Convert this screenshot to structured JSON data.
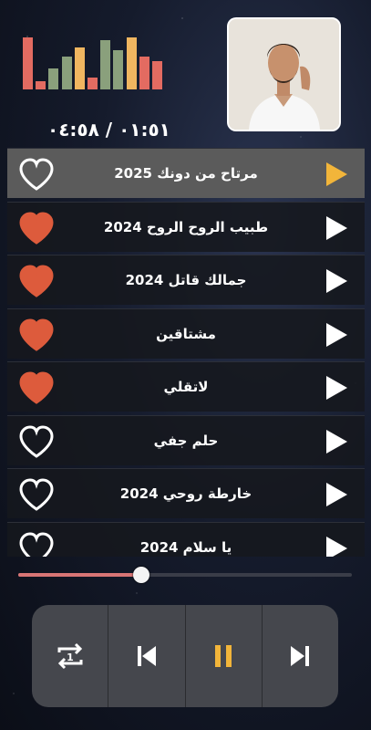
{
  "player": {
    "time_display": "٠١:٥١ / ٠٤:٥٨",
    "progress_fraction": 0.37,
    "equalizer": [
      {
        "level": 0.98,
        "color": "#e36b61"
      },
      {
        "level": 0.16,
        "color": "#e36b61"
      },
      {
        "level": 0.4,
        "color": "#8aa07c"
      },
      {
        "level": 0.62,
        "color": "#8aa07c"
      },
      {
        "level": 0.79,
        "color": "#f0b660"
      },
      {
        "level": 0.22,
        "color": "#e36b61"
      },
      {
        "level": 0.93,
        "color": "#8aa07c"
      },
      {
        "level": 0.74,
        "color": "#8aa07c"
      },
      {
        "level": 0.98,
        "color": "#f0b660"
      },
      {
        "level": 0.62,
        "color": "#e36b61"
      },
      {
        "level": 0.54,
        "color": "#e36b61"
      }
    ]
  },
  "songs": [
    {
      "title": "مرتاح من دونك 2025",
      "favorite": false,
      "active": true
    },
    {
      "title": "طبيب الروح الروح 2024",
      "favorite": true,
      "active": false
    },
    {
      "title": "جمالك قاتل 2024",
      "favorite": true,
      "active": false
    },
    {
      "title": "مشتاقين",
      "favorite": true,
      "active": false
    },
    {
      "title": "لاتقلي",
      "favorite": true,
      "active": false
    },
    {
      "title": "حلم جفي",
      "favorite": false,
      "active": false
    },
    {
      "title": "خارطة روحي 2024",
      "favorite": false,
      "active": false
    },
    {
      "title": "يا سلام 2024",
      "favorite": false,
      "active": false
    }
  ],
  "colors": {
    "heart_filled": "#dd5b3c",
    "play_active": "#f2b53a",
    "play_default": "#ffffff",
    "pause": "#f2b53a",
    "progress_fill": "#d87575"
  },
  "controls": [
    {
      "name": "repeat-one-button",
      "icon": "repeat-one-icon"
    },
    {
      "name": "previous-button",
      "icon": "skip-previous-icon"
    },
    {
      "name": "pause-button",
      "icon": "pause-icon"
    },
    {
      "name": "next-button",
      "icon": "skip-next-icon"
    }
  ]
}
